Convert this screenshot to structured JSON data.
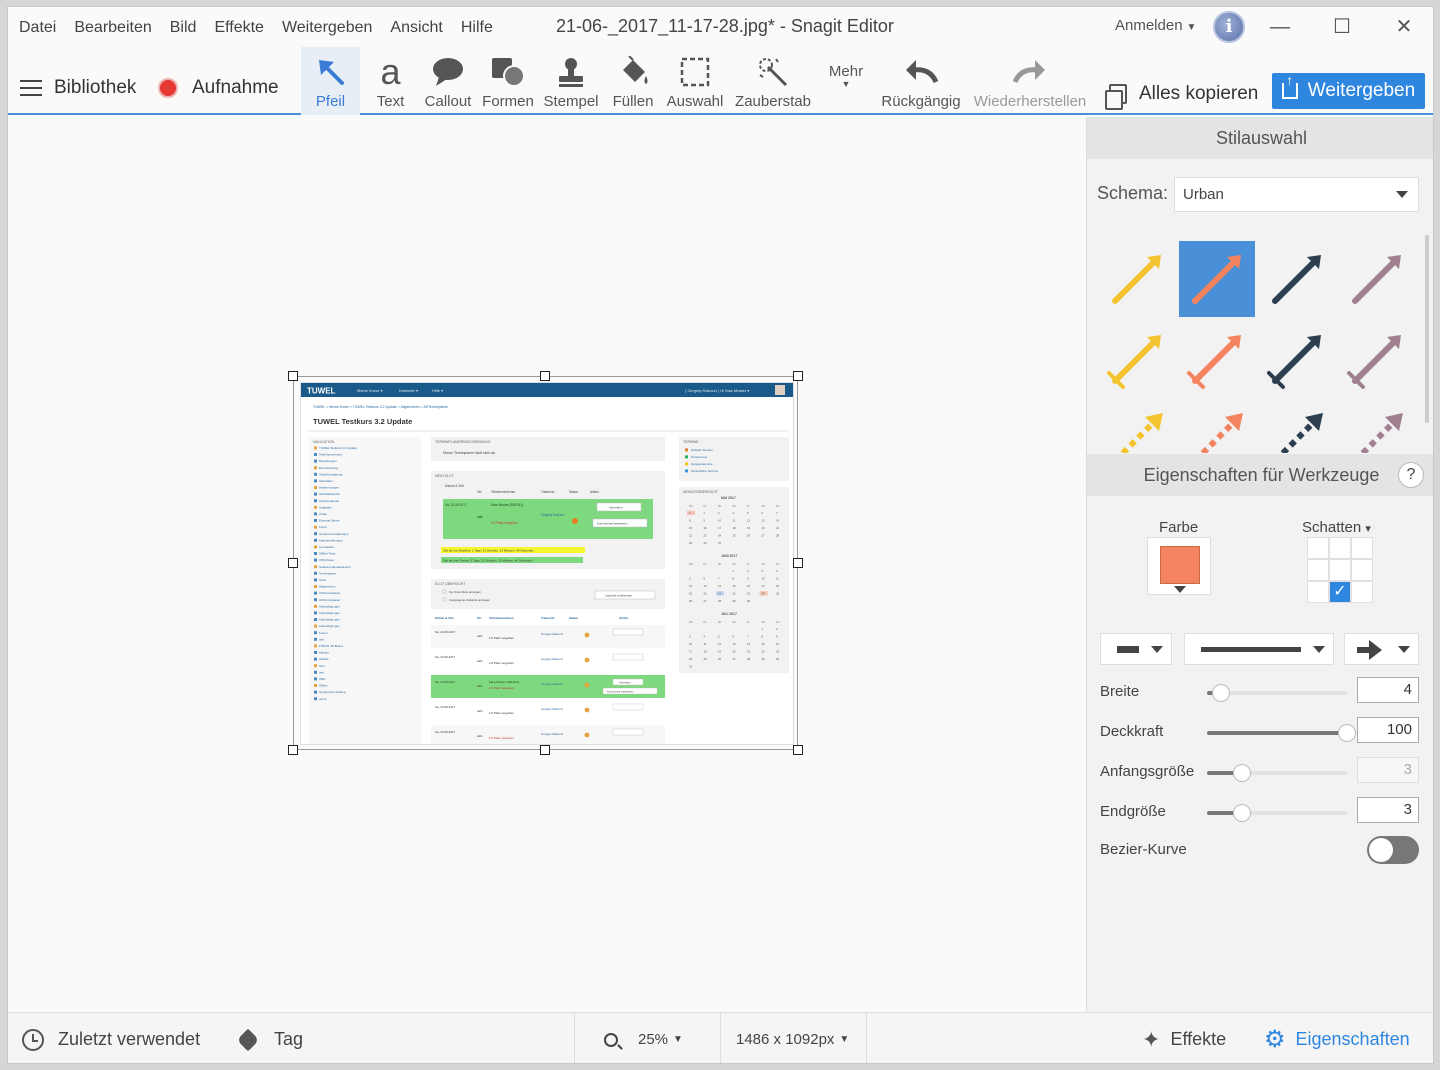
{
  "menu": [
    "Datei",
    "Bearbeiten",
    "Bild",
    "Effekte",
    "Weitergeben",
    "Ansicht",
    "Hilfe"
  ],
  "window_title": "21-06-_2017_11-17-28.jpg* - Snagit Editor",
  "account": {
    "sign_in": "Anmelden",
    "avatar_letter": "i"
  },
  "window_controls": {
    "minimize": "—",
    "maximize": "☐",
    "close": "✕"
  },
  "toolbar": {
    "library": "Bibliothek",
    "capture": "Aufnahme",
    "tools": [
      {
        "label": "Pfeil",
        "icon": "arrow-tool-icon"
      },
      {
        "label": "Text",
        "icon": "text-tool-icon"
      },
      {
        "label": "Callout",
        "icon": "callout-tool-icon"
      },
      {
        "label": "Formen",
        "icon": "shapes-tool-icon"
      },
      {
        "label": "Stempel",
        "icon": "stamp-tool-icon"
      },
      {
        "label": "Füllen",
        "icon": "fill-tool-icon"
      },
      {
        "label": "Auswahl",
        "icon": "selection-tool-icon"
      },
      {
        "label": "Zauberstab",
        "icon": "magic-wand-tool-icon"
      }
    ],
    "more": "Mehr",
    "undo": "Rückgängig",
    "redo": "Wiederherstellen",
    "copy_all": "Alles kopieren",
    "share": "Weitergeben",
    "text_glyph": "a"
  },
  "panel": {
    "style_header": "Stilauswahl",
    "schema_label": "Schema:",
    "schema_value": "Urban",
    "tool_props_header": "Eigenschaften für Werkzeuge",
    "help": "?",
    "color_label": "Farbe",
    "shadow_label": "Schatten",
    "shadow_caret": "▾",
    "selected_color": "#f4845f",
    "style_colors": [
      "#f4c430",
      "#f4845f",
      "#2c3e50",
      "#a08090"
    ],
    "props": [
      {
        "label": "Breite",
        "value": "4",
        "slider": 0.1
      },
      {
        "label": "Deckkraft",
        "value": "100",
        "slider": 1.0
      },
      {
        "label": "Anfangsgröße",
        "value": "3",
        "slider": 0.25,
        "disabled": true
      },
      {
        "label": "Endgröße",
        "value": "3",
        "slider": 0.25
      }
    ],
    "bezier_label": "Bezier-Kurve"
  },
  "statusbar": {
    "recent": "Zuletzt verwendet",
    "tag": "Tag",
    "zoom": "25%",
    "dimensions": "1486 x 1092px",
    "effects": "Effekte",
    "properties": "Eigenschaften"
  },
  "captured_page": {
    "site_logo": "TUWEL",
    "nav_menu": [
      "Meine Kurse ▾",
      "Kalender ▾",
      "Hilfe ▾"
    ],
    "user": "( Gergely Rakoczi )   Hi Max Muster ▾",
    "breadcrumb": "TUWEL  >  Meine Kurse  >  TUWEL Testkurs 3.2 Update  >  Allgemeines  >  AKTerminplaner",
    "course_title": "TUWEL Testkurs 3.2 Update",
    "navigation_title": "NAVIGATION",
    "navigation_items": [
      "TUWEL Testkurs 3.2 Update",
      "Teilnehmer/innen",
      "Bewertungen",
      "Einschreibung",
      "Objektverwaltung",
      "Aktivitäten",
      "Abstimmungen",
      "Aktivitätsbericht",
      "Arbeitsmaterial",
      "Aufgaben",
      "Chats",
      "External Server",
      "Foren",
      "Gruppenverwaltungen",
      "Kalenderübungen",
      "Lernpakete",
      "Offline-Tests",
      "OSS-Paper",
      "Studierendenaustausch",
      "Terminplaner",
      "Tests",
      "Allgemeines",
      "AKTerminplaner",
      "AKTerminplaner",
      "Ankündigungen",
      "Ankündigungen",
      "Ankündigungen",
      "Ankündigungen",
      "Forum",
      "test",
      "FORTH 3D Board",
      "Klausur",
      "selfedit",
      "Test",
      "test",
      "OBV",
      "Offline",
      "Gruppenanmeldung",
      "unit 3"
    ],
    "description_title": "TERMINPLANERBESCHREIBUNG",
    "description_text": "Dieser Terminplaner läuft nicht ab.",
    "my_slot_title": "MEIN SLOT",
    "slot_headers": [
      "Datum & Zeit",
      "Ort",
      "Teilnehmer/innen",
      "Trainer/in",
      "Status",
      "Aktion"
    ],
    "slot_date": "Sa, 24.06.2017",
    "slot_participant": "Alice Muster (3901111)",
    "slot_free": "1/1 Platz vergeben",
    "slot_trainer": "Gergely Rakoczi",
    "slot_location": "sdfs",
    "action_unregister": "Abmelden",
    "action_comment": "Kommentar bearbeiten",
    "deadline_yellow": "Zeit bis zur Deadline: 1 Tage, 21 Stunden, 13 Minuten, 40 Sekunden",
    "deadline_green": "Zeit bis zum Termin: 3 Tage, 21 Stunden, 13 Minuten, 40 Sekunden",
    "overview_title": "SLOT ÜBERSICHT",
    "overview_opt1": "Nur freie Slots anzeigen",
    "overview_opt2": "Vergangene Zeitslots anzeigen",
    "overview_btn": "Legende einblenden",
    "terms_title": "TERMINE",
    "terms": [
      "Globale Termine",
      "Kurstermine",
      "Gruppentermine",
      "Persönliche Termine"
    ],
    "month_title": "MONATSÜBERSICHT",
    "months": [
      "MAI 2017",
      "JUNI 2017",
      "JULI 2017"
    ],
    "weekdays": [
      "Mo",
      "Di",
      "Mi",
      "Do",
      "Fr",
      "Sa",
      "So"
    ]
  }
}
